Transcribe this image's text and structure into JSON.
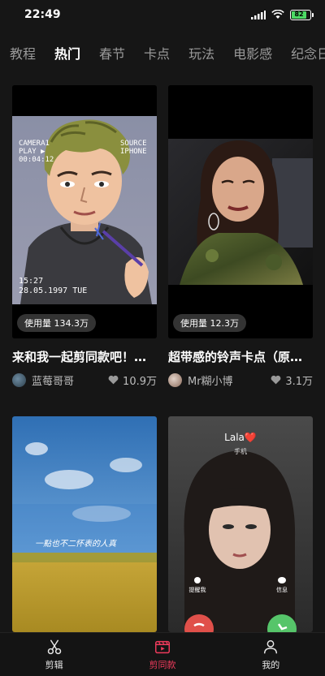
{
  "status": {
    "time": "22:49",
    "battery": "82"
  },
  "tabs": [
    {
      "label": "教程"
    },
    {
      "label": "热门",
      "active": true
    },
    {
      "label": "春节"
    },
    {
      "label": "卡点"
    },
    {
      "label": "玩法"
    },
    {
      "label": "电影感"
    },
    {
      "label": "纪念日"
    }
  ],
  "cards": [
    {
      "usage": "使用量 134.3万",
      "title": "来和我一起剪同款吧！（...",
      "author": "蓝莓哥哥",
      "likes": "10.9万",
      "overlay": {
        "cam": "CAMERA1",
        "play": "PLAY ▶",
        "timecode": "00:04:12",
        "source": "SOURCE",
        "device": "IPHONE",
        "clock": "15:27",
        "date": "28.05.1997 TUE"
      }
    },
    {
      "usage": "使用量 12.3万",
      "title": "超带感的铃声卡点（原声...",
      "author": "Mr糊小博",
      "likes": "3.1万"
    },
    {
      "overlay": {
        "caption": "一點也不二怀表的人真"
      }
    },
    {
      "overlay": {
        "caller": "Lala❤️",
        "caller_sub": "手机",
        "remind": "提醒我",
        "message": "信息"
      }
    }
  ],
  "nav": [
    {
      "label": "剪辑",
      "icon": "scissors-icon"
    },
    {
      "label": "剪同款",
      "icon": "template-icon",
      "active": true
    },
    {
      "label": "我的",
      "icon": "profile-icon"
    }
  ],
  "colors": {
    "accent": "#ef3b5c",
    "background": "#161616"
  }
}
